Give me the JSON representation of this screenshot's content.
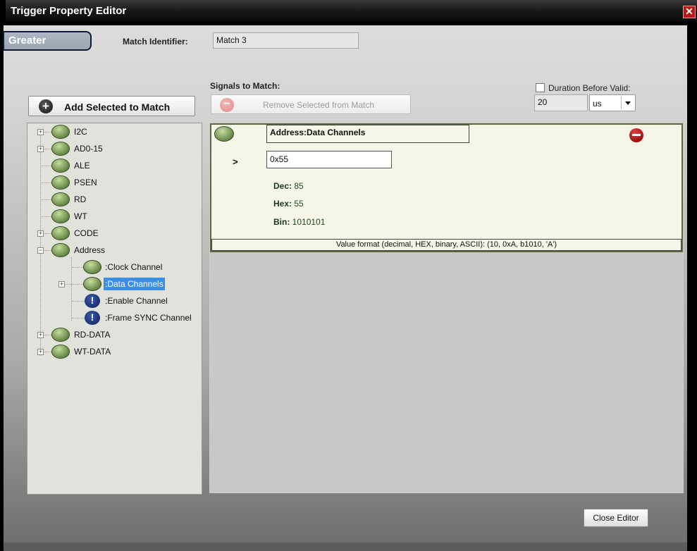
{
  "window": {
    "title": "Trigger Property Editor"
  },
  "mode_tab": "Greater",
  "match_identifier": {
    "label": "Match Identifier:",
    "value": "Match 3"
  },
  "signals_to_match_label": "Signals to Match:",
  "buttons": {
    "add_selected": "Add Selected to Match",
    "remove_selected": "Remove Selected from Match",
    "close_editor": "Close Editor"
  },
  "duration": {
    "label": "Duration Before Valid:",
    "checked": false,
    "value": "20",
    "unit": "us"
  },
  "tree": {
    "items": [
      {
        "label": "I2C",
        "expandable": true
      },
      {
        "label": "AD0-15",
        "expandable": true
      },
      {
        "label": "ALE",
        "expandable": false
      },
      {
        "label": "PSEN",
        "expandable": false
      },
      {
        "label": "RD",
        "expandable": false
      },
      {
        "label": "WT",
        "expandable": false
      },
      {
        "label": "CODE",
        "expandable": true
      },
      {
        "label": "Address",
        "expandable": true,
        "expanded": true
      },
      {
        "label": ":Clock Channel",
        "expandable": false
      },
      {
        "label": ":Data Channels",
        "expandable": true,
        "selected": true
      },
      {
        "label": ":Enable Channel",
        "expandable": false,
        "icon": "warning-icon"
      },
      {
        "label": ":Frame SYNC Channel",
        "expandable": false,
        "icon": "warning-icon"
      },
      {
        "label": "RD-DATA",
        "expandable": true
      },
      {
        "label": "WT-DATA",
        "expandable": true
      }
    ]
  },
  "match_card": {
    "name": "Address:Data Channels",
    "operator": ">",
    "value": "0x55",
    "dec_label": "Dec:",
    "dec_value": "85",
    "hex_label": "Hex:",
    "hex_value": "55",
    "bin_label": "Bin:",
    "bin_value": "1010101",
    "format_hint": "Value format (decimal, HEX, binary, ASCII):  (10, 0xA, b1010, 'A')"
  }
}
